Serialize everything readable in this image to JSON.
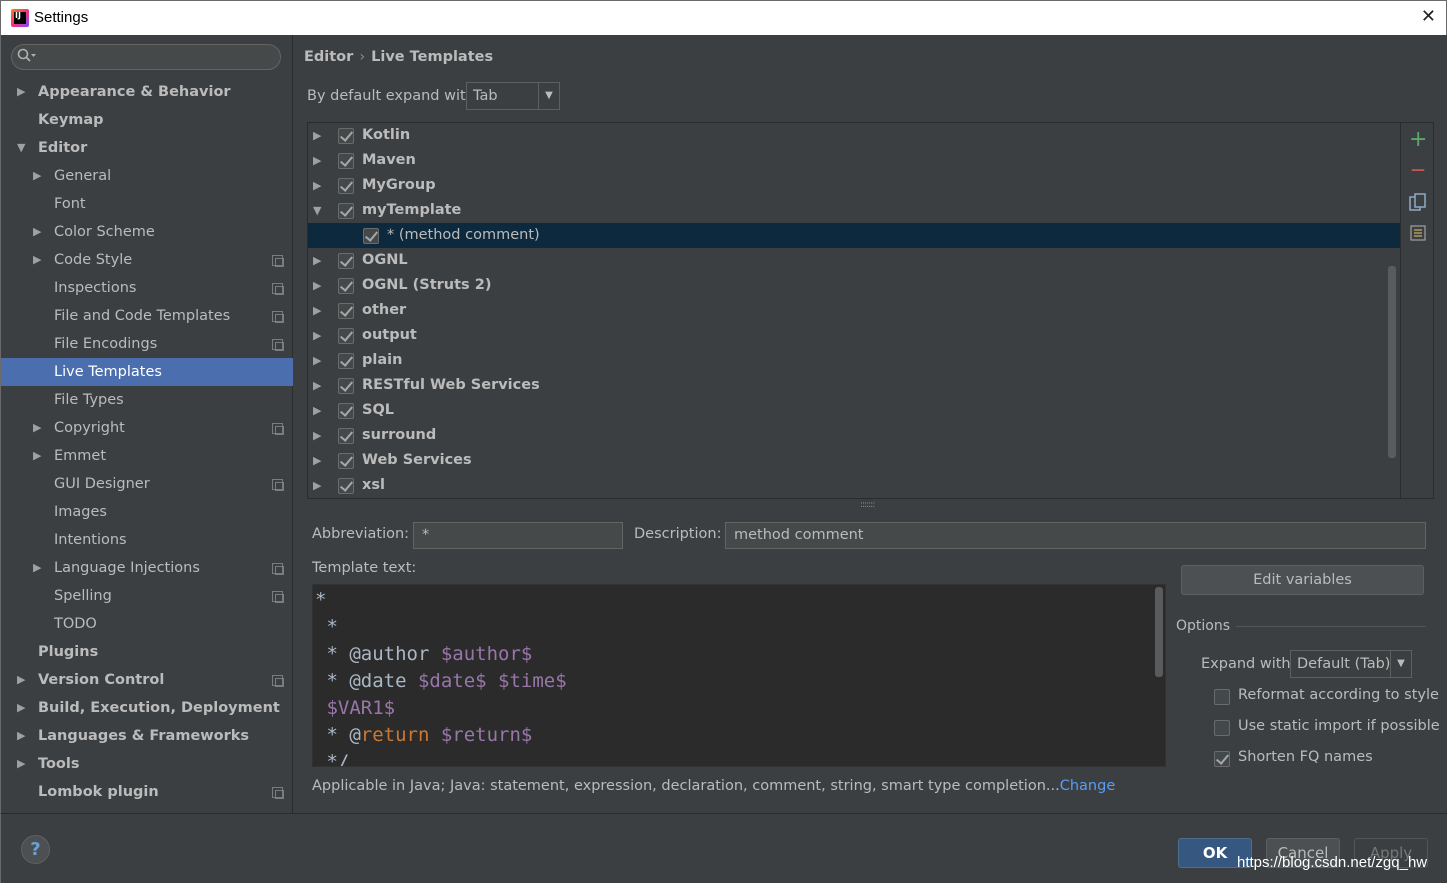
{
  "window": {
    "title": "Settings",
    "app_icon_text": "IJ",
    "close_glyph": "✕"
  },
  "search": {
    "icon": "search-icon",
    "placeholder": ""
  },
  "sidebar": {
    "items": [
      {
        "label": "Appearance & Behavior",
        "level": 0,
        "arrow": "right",
        "bold": true,
        "copy": false
      },
      {
        "label": "Keymap",
        "level": 0,
        "arrow": "none",
        "bold": true,
        "copy": false
      },
      {
        "label": "Editor",
        "level": 0,
        "arrow": "down",
        "bold": true,
        "copy": false
      },
      {
        "label": "General",
        "level": 1,
        "arrow": "right",
        "bold": false,
        "copy": false
      },
      {
        "label": "Font",
        "level": 1,
        "arrow": "none",
        "bold": false,
        "copy": false
      },
      {
        "label": "Color Scheme",
        "level": 1,
        "arrow": "right",
        "bold": false,
        "copy": false
      },
      {
        "label": "Code Style",
        "level": 1,
        "arrow": "right",
        "bold": false,
        "copy": true
      },
      {
        "label": "Inspections",
        "level": 1,
        "arrow": "none",
        "bold": false,
        "copy": true
      },
      {
        "label": "File and Code Templates",
        "level": 1,
        "arrow": "none",
        "bold": false,
        "copy": true
      },
      {
        "label": "File Encodings",
        "level": 1,
        "arrow": "none",
        "bold": false,
        "copy": true
      },
      {
        "label": "Live Templates",
        "level": 1,
        "arrow": "none",
        "bold": false,
        "copy": false,
        "selected": true
      },
      {
        "label": "File Types",
        "level": 1,
        "arrow": "none",
        "bold": false,
        "copy": false
      },
      {
        "label": "Copyright",
        "level": 1,
        "arrow": "right",
        "bold": false,
        "copy": true
      },
      {
        "label": "Emmet",
        "level": 1,
        "arrow": "right",
        "bold": false,
        "copy": false
      },
      {
        "label": "GUI Designer",
        "level": 1,
        "arrow": "none",
        "bold": false,
        "copy": true
      },
      {
        "label": "Images",
        "level": 1,
        "arrow": "none",
        "bold": false,
        "copy": false
      },
      {
        "label": "Intentions",
        "level": 1,
        "arrow": "none",
        "bold": false,
        "copy": false
      },
      {
        "label": "Language Injections",
        "level": 1,
        "arrow": "right",
        "bold": false,
        "copy": true
      },
      {
        "label": "Spelling",
        "level": 1,
        "arrow": "none",
        "bold": false,
        "copy": true
      },
      {
        "label": "TODO",
        "level": 1,
        "arrow": "none",
        "bold": false,
        "copy": false
      },
      {
        "label": "Plugins",
        "level": 0,
        "arrow": "none",
        "bold": true,
        "copy": false
      },
      {
        "label": "Version Control",
        "level": 0,
        "arrow": "right",
        "bold": true,
        "copy": true
      },
      {
        "label": "Build, Execution, Deployment",
        "level": 0,
        "arrow": "right",
        "bold": true,
        "copy": false
      },
      {
        "label": "Languages & Frameworks",
        "level": 0,
        "arrow": "right",
        "bold": true,
        "copy": false
      },
      {
        "label": "Tools",
        "level": 0,
        "arrow": "right",
        "bold": true,
        "copy": false
      },
      {
        "label": "Lombok plugin",
        "level": 0,
        "arrow": "none",
        "bold": true,
        "copy": true
      }
    ]
  },
  "breadcrumb": {
    "parent": "Editor",
    "separator": "›",
    "current": "Live Templates"
  },
  "expand": {
    "label": "By default expand with",
    "value": "Tab"
  },
  "templates": [
    {
      "name": "Kotlin",
      "checked": true,
      "expanded": false,
      "child": false
    },
    {
      "name": "Maven",
      "checked": true,
      "expanded": false,
      "child": false
    },
    {
      "name": "MyGroup",
      "checked": true,
      "expanded": false,
      "child": false
    },
    {
      "name": "myTemplate",
      "checked": true,
      "expanded": true,
      "child": false
    },
    {
      "name": "* (method comment)",
      "checked": true,
      "expanded": false,
      "child": true,
      "selected": true
    },
    {
      "name": "OGNL",
      "checked": true,
      "expanded": false,
      "child": false
    },
    {
      "name": "OGNL (Struts 2)",
      "checked": true,
      "expanded": false,
      "child": false
    },
    {
      "name": "other",
      "checked": true,
      "expanded": false,
      "child": false
    },
    {
      "name": "output",
      "checked": true,
      "expanded": false,
      "child": false
    },
    {
      "name": "plain",
      "checked": true,
      "expanded": false,
      "child": false
    },
    {
      "name": "RESTful Web Services",
      "checked": true,
      "expanded": false,
      "child": false
    },
    {
      "name": "SQL",
      "checked": true,
      "expanded": false,
      "child": false
    },
    {
      "name": "surround",
      "checked": true,
      "expanded": false,
      "child": false
    },
    {
      "name": "Web Services",
      "checked": true,
      "expanded": false,
      "child": false
    },
    {
      "name": "xsl",
      "checked": true,
      "expanded": false,
      "child": false
    }
  ],
  "toolbar": {
    "add": "+",
    "remove": "—",
    "copy_icon": "copy-icon",
    "page_icon": "page-icon"
  },
  "abbreviation": {
    "label": "Abbreviation:",
    "value": "*"
  },
  "description": {
    "label": "Description:",
    "value": "method comment"
  },
  "template_text": {
    "label": "Template text:",
    "lines": [
      [
        {
          "t": "*",
          "c": ""
        }
      ],
      [
        {
          "t": " *",
          "c": ""
        }
      ],
      [
        {
          "t": " * @author ",
          "c": ""
        },
        {
          "t": "$author$",
          "c": "var"
        }
      ],
      [
        {
          "t": " * @date ",
          "c": ""
        },
        {
          "t": "$date$",
          "c": "var"
        },
        {
          "t": " ",
          "c": ""
        },
        {
          "t": "$time$",
          "c": "var"
        }
      ],
      [
        {
          "t": " ",
          "c": ""
        },
        {
          "t": "$VAR1$",
          "c": "var"
        }
      ],
      [
        {
          "t": " * @",
          "c": ""
        },
        {
          "t": "return",
          "c": "kw"
        },
        {
          "t": " ",
          "c": ""
        },
        {
          "t": "$return$",
          "c": "var"
        }
      ],
      [
        {
          "t": " */",
          "c": ""
        }
      ]
    ]
  },
  "edit_variables_label": "Edit variables",
  "options": {
    "title": "Options",
    "expand_label": "Expand with",
    "expand_value": "Default (Tab)",
    "reformat": {
      "label": "Reformat according to style",
      "checked": false
    },
    "static_import": {
      "label": "Use static import if possible",
      "checked": false
    },
    "shorten_fq": {
      "label": "Shorten FQ names",
      "checked": true
    }
  },
  "applicable": {
    "text": "Applicable in Java; Java: statement, expression, declaration, comment, string, smart type completion...",
    "link": "Change"
  },
  "footer": {
    "help": "?",
    "ok": "OK",
    "cancel": "Cancel",
    "apply": "Apply",
    "watermark": "https://blog.csdn.net/zgq_hw"
  },
  "colors": {
    "accent": "#4b6eaf",
    "selected_row": "#0d293e",
    "link": "#589df6",
    "var": "#9876aa",
    "keyword": "#cc7832",
    "add": "#59a869",
    "remove": "#c75450"
  }
}
